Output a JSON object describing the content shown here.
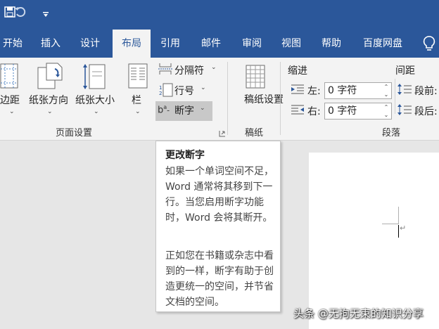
{
  "quick_access": {
    "save_icon": "save-icon",
    "undo_icon": "undo-icon",
    "customize_icon": "customize-icon"
  },
  "tabs": [
    {
      "label": "开始"
    },
    {
      "label": "插入"
    },
    {
      "label": "设计"
    },
    {
      "label": "布局",
      "active": true
    },
    {
      "label": "引用"
    },
    {
      "label": "邮件"
    },
    {
      "label": "审阅"
    },
    {
      "label": "视图"
    },
    {
      "label": "帮助"
    },
    {
      "label": "百度网盘"
    }
  ],
  "ribbon": {
    "page_setup": {
      "margins": "页边距",
      "orientation": "纸张方向",
      "size": "纸张大小",
      "columns": "栏",
      "breaks": "分隔符",
      "line_numbers": "行号",
      "hyphenation": "断字",
      "group_label": "页面设置"
    },
    "draft": {
      "button": "稿纸设置",
      "group_label": "稿纸"
    },
    "paragraph": {
      "indent_title": "缩进",
      "spacing_title": "间距",
      "left_label": "左:",
      "right_label": "右:",
      "left_value": "0 字符",
      "right_value": "0 字符",
      "before_label": "段前:",
      "after_label": "段后:",
      "group_label": "段落"
    }
  },
  "tooltip": {
    "title": "更改断字",
    "p1": "如果一个单词空间不足，Word 通常将其移到下一行。当您启用断字功能时，Word 会将其断开。",
    "p2": "正如您在书籍或杂志中看到的一样，断字有助于创造更统一的空间，并节省文档的空间。"
  },
  "watermark": "头条 @无拘无束的知识分享",
  "colors": {
    "title_bar": "#2b579a",
    "ribbon": "#f3f3f3",
    "doc_bg": "#e6e6e6",
    "hyphenation_highlight": "#c8c8c8"
  }
}
